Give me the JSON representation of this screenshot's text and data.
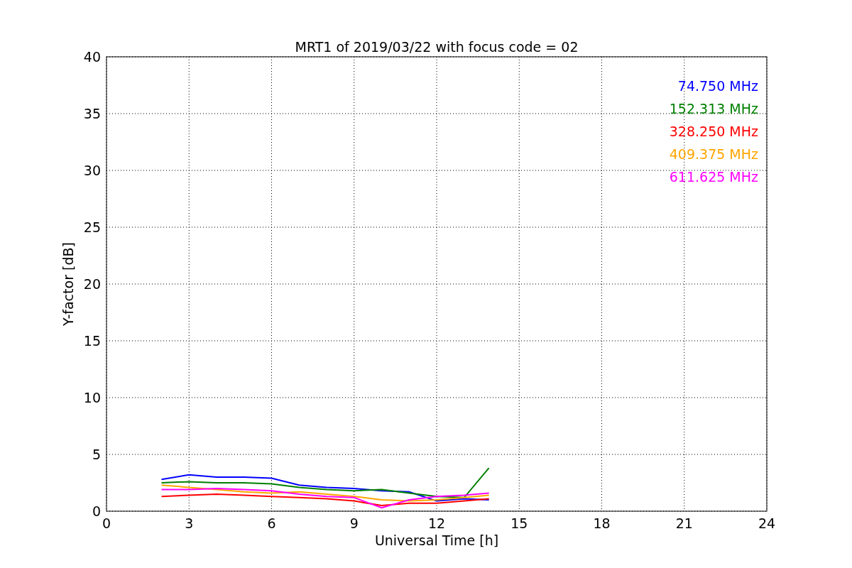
{
  "figure": {
    "chart_data": {
      "type": "line",
      "title": "MRT1 of 2019/03/22 with focus code = 02",
      "xlabel": "Universal Time [h]",
      "ylabel": "Y-factor [dB]",
      "x": [
        2,
        3,
        4,
        5,
        6,
        7,
        8,
        9,
        10,
        11,
        12,
        13,
        13.9
      ],
      "series": [
        {
          "name": "74.750 MHz",
          "color": "#0000ff",
          "values": [
            2.8,
            3.2,
            3.0,
            3.0,
            2.9,
            2.3,
            2.1,
            2.0,
            1.8,
            1.7,
            0.9,
            1.1,
            1.0
          ]
        },
        {
          "name": "152.313 MHz",
          "color": "#008000",
          "values": [
            2.5,
            2.6,
            2.5,
            2.5,
            2.4,
            2.1,
            1.9,
            1.8,
            1.9,
            1.6,
            1.3,
            1.2,
            3.8
          ]
        },
        {
          "name": "328.250 MHz",
          "color": "#ff0000",
          "values": [
            1.3,
            1.4,
            1.5,
            1.4,
            1.3,
            1.2,
            1.1,
            0.9,
            0.5,
            0.7,
            0.7,
            0.9,
            1.1
          ]
        },
        {
          "name": "409.375 MHz",
          "color": "#ffa500",
          "values": [
            2.3,
            2.1,
            1.9,
            1.7,
            1.6,
            1.7,
            1.5,
            1.3,
            1.0,
            0.9,
            1.0,
            1.2,
            1.4
          ]
        },
        {
          "name": "611.625 MHz",
          "color": "#ff00ff",
          "values": [
            1.9,
            1.9,
            2.0,
            1.9,
            1.8,
            1.5,
            1.3,
            1.2,
            0.3,
            1.0,
            1.3,
            1.4,
            1.6
          ]
        }
      ],
      "grid": true,
      "xlim": [
        0,
        24
      ],
      "ylim": [
        0,
        40
      ],
      "xticks": [
        0,
        3,
        6,
        9,
        12,
        15,
        18,
        21,
        24
      ],
      "yticks": [
        0,
        5,
        10,
        15,
        20,
        25,
        30,
        35,
        40
      ]
    }
  }
}
